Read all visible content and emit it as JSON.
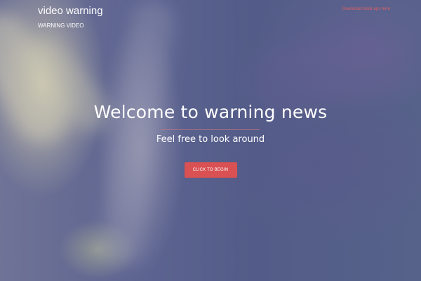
{
  "header": {
    "brand": "video warning",
    "tagline": "WARNING VIDEO",
    "nav_link": "Download mock-ups here"
  },
  "hero": {
    "title": "Welcome to warning news",
    "subtitle": "Feel free to look around",
    "cta_label": "CLICK TO BEGIN"
  },
  "colors": {
    "accent": "#d95153",
    "background": "#545e86",
    "text": "#ffffff"
  }
}
